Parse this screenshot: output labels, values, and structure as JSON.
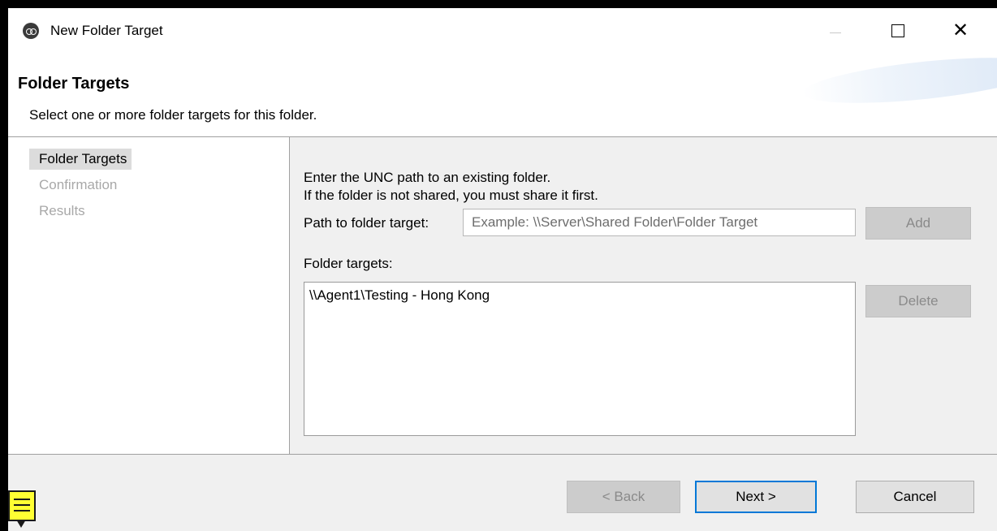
{
  "window": {
    "title": "New Folder Target",
    "icon": "app-logo-icon",
    "controls": {
      "minimize": "minimize-icon",
      "maximize": "maximize-icon",
      "close": "close-icon",
      "close_glyph": "✕"
    }
  },
  "header": {
    "title": "Folder Targets",
    "description": "Select one or more folder targets for this folder."
  },
  "steps": [
    {
      "label": "Folder Targets",
      "state": "active"
    },
    {
      "label": "Confirmation",
      "state": "inactive"
    },
    {
      "label": "Results",
      "state": "inactive"
    }
  ],
  "main": {
    "instruction_line1": "Enter the UNC path to an existing folder.",
    "instruction_line2": "If the folder is not shared, you must share it first.",
    "path_label": "Path to folder target:",
    "path_value": "",
    "path_placeholder": "Example: \\\\Server\\Shared Folder\\Folder Target",
    "add_label": "Add",
    "targets_label": "Folder targets:",
    "targets": [
      "\\\\Agent1\\Testing - Hong Kong"
    ],
    "delete_label": "Delete"
  },
  "footer": {
    "back_label": "< Back",
    "next_label": "Next >",
    "cancel_label": "Cancel"
  },
  "colors": {
    "accent": "#0078d7",
    "note_marker": "#ffff33",
    "disabled_text": "#a8a8a8"
  }
}
